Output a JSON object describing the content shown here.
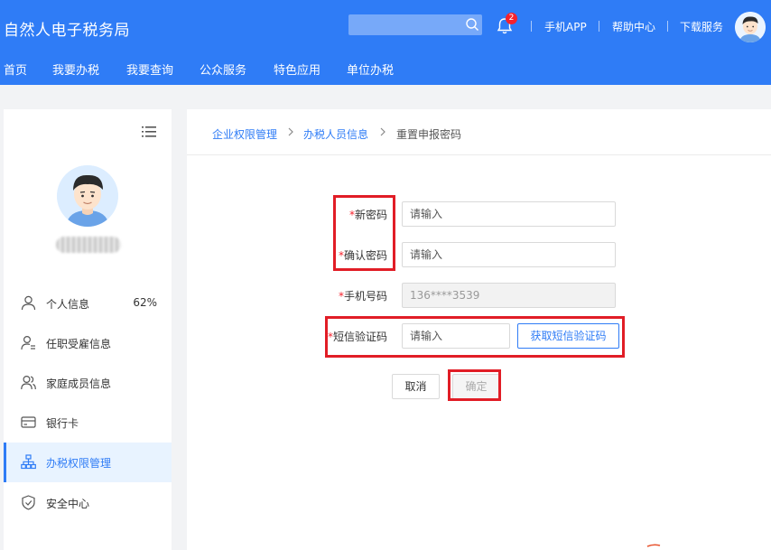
{
  "header": {
    "title": "自然人电子税务局",
    "search_placeholder": "",
    "notification_count": "2",
    "links": [
      "手机APP",
      "帮助中心",
      "下载服务"
    ]
  },
  "nav": {
    "items": [
      "首页",
      "我要办税",
      "我要查询",
      "公众服务",
      "特色应用",
      "单位办税"
    ]
  },
  "sidebar": {
    "items": [
      {
        "label": "个人信息",
        "value": "62%",
        "icon": "user-icon"
      },
      {
        "label": "任职受雇信息",
        "icon": "employment-icon"
      },
      {
        "label": "家庭成员信息",
        "icon": "family-icon"
      },
      {
        "label": "银行卡",
        "icon": "bank-card-icon"
      },
      {
        "label": "办税权限管理",
        "icon": "org-tree-icon"
      },
      {
        "label": "安全中心",
        "icon": "shield-icon"
      }
    ],
    "active_index": 4
  },
  "breadcrumb": [
    "企业权限管理",
    "办税人员信息",
    "重置申报密码"
  ],
  "form": {
    "new_password": {
      "label": "新密码",
      "placeholder": "请输入"
    },
    "confirm_password": {
      "label": "确认密码",
      "placeholder": "请输入"
    },
    "phone": {
      "label": "手机号码",
      "value": "136****3539"
    },
    "sms_code": {
      "label": "短信验证码",
      "placeholder": "请输入",
      "button": "获取短信验证码"
    },
    "required_mark": "*"
  },
  "actions": {
    "cancel": "取消",
    "confirm": "确定"
  },
  "colors": {
    "primary": "#2f7cf6",
    "highlight": "#e11d26",
    "required": "#f5222d"
  }
}
